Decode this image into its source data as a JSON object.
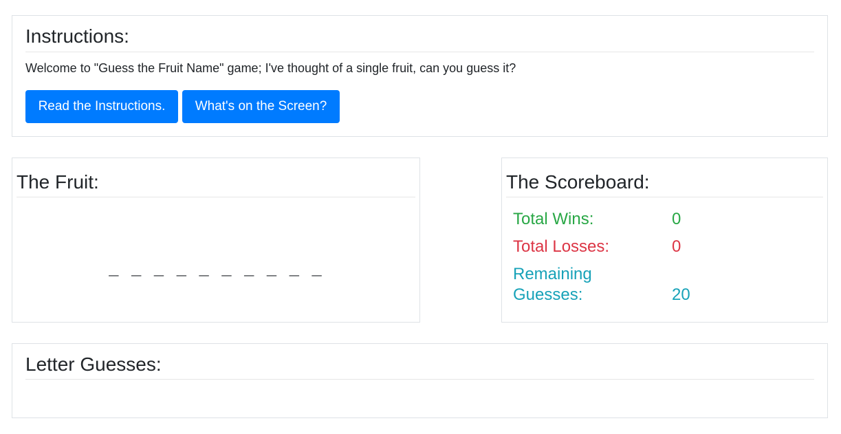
{
  "instructions": {
    "title": "Instructions:",
    "intro": "Welcome to \"Guess the Fruit Name\" game; I've thought of a single fruit, can you guess it?",
    "read_button": "Read the Instructions.",
    "screen_button": "What's on the Screen?"
  },
  "fruit": {
    "title": "The Fruit:",
    "word_display": "_ _ _ _ _ _ _ _ _ _"
  },
  "scoreboard": {
    "title": "The Scoreboard:",
    "wins_label": "Total Wins:",
    "wins_value": "0",
    "losses_label": "Total Losses:",
    "losses_value": "0",
    "remaining_label": "Remaining Guesses:",
    "remaining_value": "20"
  },
  "guesses": {
    "title": "Letter Guesses:",
    "letters": ""
  },
  "colors": {
    "primary_button": "#007bff",
    "wins": "#28a745",
    "losses": "#dc3545",
    "remaining": "#17a2b8"
  }
}
